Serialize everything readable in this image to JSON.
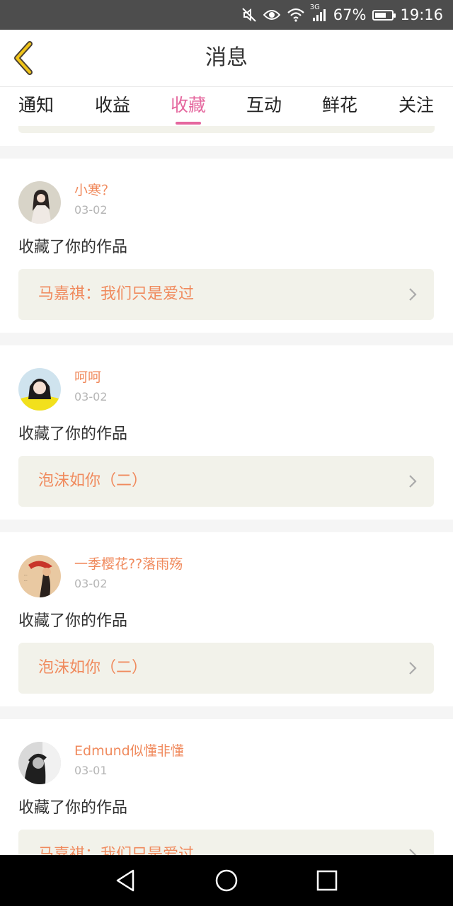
{
  "status_bar": {
    "network": "3G",
    "battery": "67%",
    "battery_level": 0.67,
    "time": "19:16",
    "icons": [
      "mute-icon",
      "eye-icon",
      "wifi-icon",
      "signal-icon",
      "battery-icon"
    ]
  },
  "header": {
    "title": "消息",
    "back_icon": "chevron-left-icon"
  },
  "tabs": [
    {
      "label": "通知",
      "active": false
    },
    {
      "label": "收益",
      "active": false
    },
    {
      "label": "收藏",
      "active": true
    },
    {
      "label": "互动",
      "active": false
    },
    {
      "label": "鲜花",
      "active": false
    },
    {
      "label": "关注",
      "active": false
    }
  ],
  "messages": [
    {
      "user": "小寒？",
      "date": "03-02",
      "text": "收藏了你的作品",
      "work": "马嘉祺：我们只是爱过"
    },
    {
      "user": "呵呵",
      "date": "03-02",
      "text": "收藏了你的作品",
      "work": "泡沫如你（二）"
    },
    {
      "user": "一季樱花??落雨殇",
      "date": "03-02",
      "text": "收藏了你的作品",
      "work": "泡沫如你（二）"
    },
    {
      "user": "Edmund似懂非懂",
      "date": "03-01",
      "text": "收藏了你的作品",
      "work": "马嘉祺：我们只是爱过"
    }
  ],
  "colors": {
    "accent": "#e5679e",
    "username": "#f08a5d",
    "work_title": "#f08a5d",
    "work_bg": "#f2f2ea",
    "back_icon": "#f0c419"
  },
  "nav_bar": {
    "icons": [
      "back-triangle-icon",
      "home-circle-icon",
      "recents-square-icon"
    ]
  }
}
